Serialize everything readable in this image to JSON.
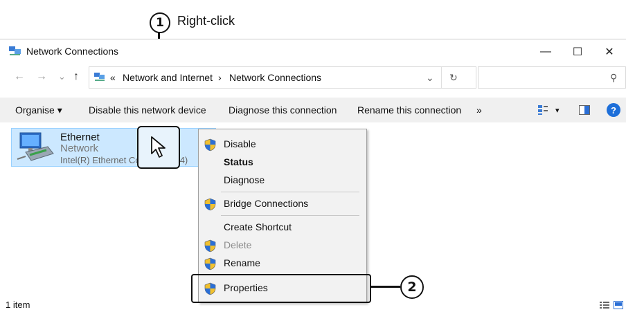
{
  "annotations": {
    "step1_number": "1",
    "step1_label": "Right-click",
    "step2_number": "2"
  },
  "window": {
    "title": "Network Connections",
    "min_glyph": "—",
    "max_glyph": "☐",
    "close_glyph": "✕"
  },
  "address": {
    "overflow": "«",
    "crumb1": "Network and Internet",
    "sep": "›",
    "crumb2": "Network Connections",
    "dropdown_glyph": "⌄",
    "refresh_glyph": "↻",
    "search_placeholder": "",
    "search_glyph": "⚲"
  },
  "nav": {
    "back": "←",
    "forward": "→",
    "recent": "⌄",
    "up": "↑"
  },
  "commands": {
    "organise": "Organise ▾",
    "disable": "Disable this network device",
    "diagnose": "Diagnose this connection",
    "rename": "Rename this connection",
    "more": "»",
    "view_arrow": "▾",
    "help": "?"
  },
  "item": {
    "name": "Ethernet",
    "network": "Network",
    "device": "Intel(R) Ethernet Connection (4)"
  },
  "status": {
    "count": "1 item"
  },
  "menu": {
    "disable": "Disable",
    "status": "Status",
    "diagnose": "Diagnose",
    "bridge": "Bridge Connections",
    "shortcut": "Create Shortcut",
    "delete": "Delete",
    "rename": "Rename",
    "properties": "Properties"
  },
  "colors": {
    "selection": "#cce8ff",
    "shield_blue": "#2b6fd6",
    "shield_yellow": "#f2c12e",
    "help_blue": "#1e6fd9"
  }
}
